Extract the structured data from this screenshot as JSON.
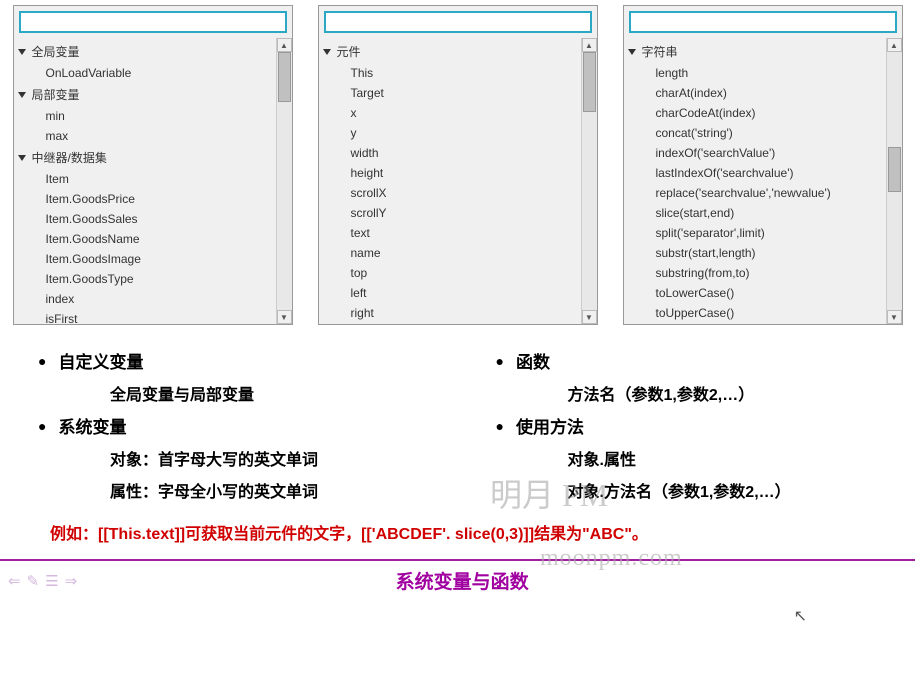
{
  "panels": {
    "left": {
      "groups": [
        {
          "label": "全局变量",
          "items": [
            "OnLoadVariable"
          ]
        },
        {
          "label": "局部变量",
          "items": [
            "min",
            "max"
          ]
        },
        {
          "label": "中继器/数据集",
          "items": [
            "Item",
            "Item.GoodsPrice",
            "Item.GoodsSales",
            "Item.GoodsName",
            "Item.GoodsImage",
            "Item.GoodsType",
            "index",
            "isFirst"
          ]
        }
      ]
    },
    "middle": {
      "groups": [
        {
          "label": "元件",
          "items": [
            "This",
            "Target",
            "x",
            "y",
            "width",
            "height",
            "scrollX",
            "scrollY",
            "text",
            "name",
            "top",
            "left",
            "right"
          ]
        }
      ]
    },
    "right": {
      "groups": [
        {
          "label": "字符串",
          "items": [
            "length",
            "charAt(index)",
            "charCodeAt(index)",
            "concat('string')",
            "indexOf('searchValue')",
            "lastIndexOf('searchvalue')",
            "replace('searchvalue','newvalue')",
            "slice(start,end)",
            "split('separator',limit)",
            "substr(start,length)",
            "substring(from,to)",
            "toLowerCase()",
            "toUpperCase()"
          ]
        }
      ]
    }
  },
  "content": {
    "left_col": {
      "head1": "自定义变量",
      "sub1": "全局变量与局部变量",
      "head2": "系统变量",
      "sub2a": "对象：首字母大写的英文单词",
      "sub2b": "属性：字母全小写的英文单词"
    },
    "right_col": {
      "head1": "函数",
      "sub1": "方法名（参数1,参数2,…）",
      "head2": "使用方法",
      "sub2a": "对象.属性",
      "sub2b": "对象.方法名（参数1,参数2,…）"
    }
  },
  "example": "例如：[[This.text]]可获取当前元件的文字，[['ABCDEF'. slice(0,3)]]结果为\"ABC\"。",
  "watermark": {
    "line1": "明月 PM",
    "line2": "moonpm.com"
  },
  "footer_title": "系统变量与函数"
}
